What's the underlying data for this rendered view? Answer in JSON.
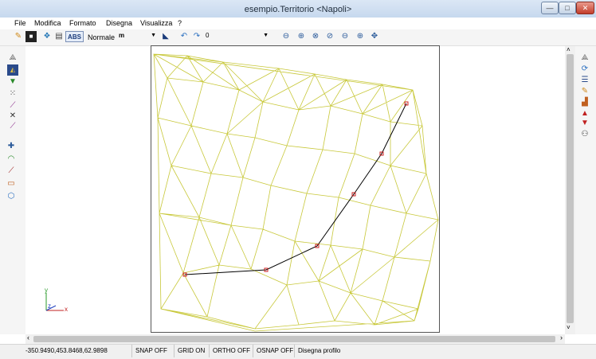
{
  "window": {
    "title": "esempio.Territorio <Napoli>",
    "minimize_glyph": "—",
    "maximize_glyph": "□",
    "close_glyph": "✕"
  },
  "menu": {
    "items": [
      "File",
      "Modifica",
      "Formato",
      "Disegna",
      "Visualizza",
      "?"
    ]
  },
  "toolbar": {
    "abs_label": "ABS",
    "mode_label": "Normale",
    "unit_value": "m",
    "layer_value": "0",
    "icons": [
      "pencil-icon",
      "color-square-icon",
      "layers-icon",
      "print-icon",
      "layer-color-icon",
      "undo-icon",
      "redo-icon",
      "zoom-icon",
      "zoom-window-icon",
      "zoom-extents-icon",
      "zoom-previous-icon",
      "zoom-out-icon",
      "zoom-in-icon",
      "pan-icon"
    ]
  },
  "left_toolbar": {
    "icons": [
      "triangulation-icon",
      "surface-icon",
      "point-icon",
      "points-icon",
      "edge-icon",
      "delete-edge-icon",
      "break-line-icon",
      "insert-point-icon",
      "contour-icon",
      "profile-icon",
      "area-icon",
      "polygon-icon"
    ]
  },
  "right_toolbar": {
    "icons": [
      "properties-icon",
      "refresh-icon",
      "list-icon",
      "edit-icon",
      "chart-icon",
      "arrow-up-icon",
      "arrow-down-icon",
      "walk-icon"
    ]
  },
  "axes": {
    "x_label": "x",
    "y_label": "y",
    "z_label": "z"
  },
  "status": {
    "coords": "-350.9490,453.8468,62.9898",
    "snap": "SNAP OFF",
    "grid": "GRID ON",
    "ortho": "ORTHO OFF",
    "osnap": "OSNAP OFF",
    "command": "Disegna profilo"
  },
  "colors": {
    "mesh": "#c8c83a",
    "profile_line": "#000000",
    "profile_marker": "#cc2222",
    "close_button": "#c33d2a"
  }
}
